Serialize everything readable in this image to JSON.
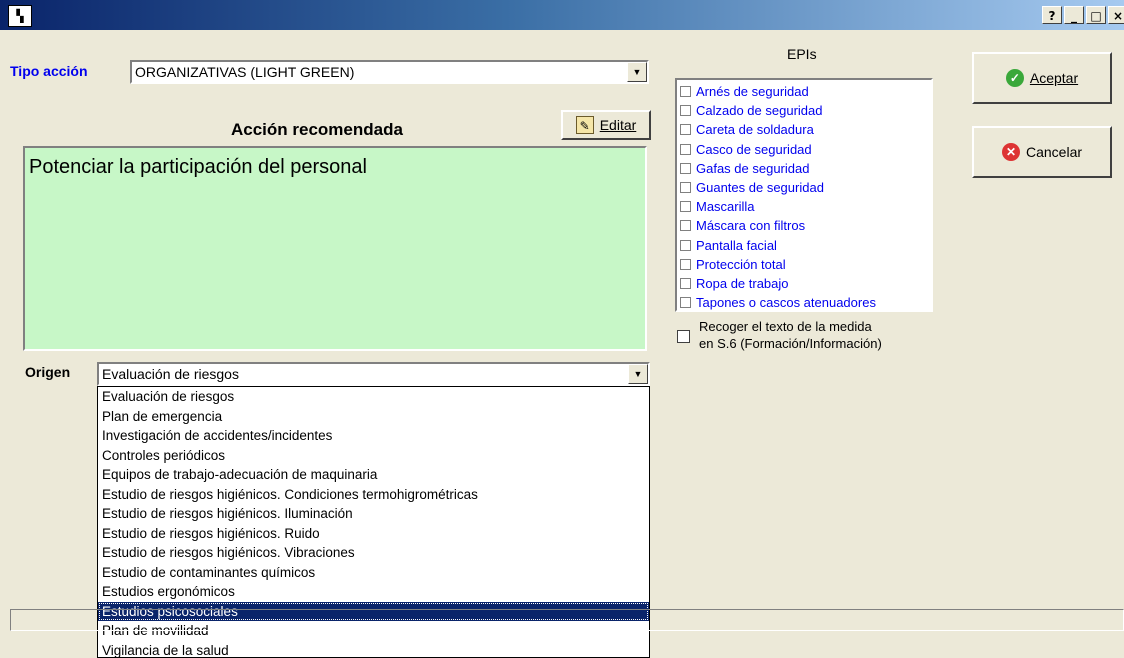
{
  "window": {
    "help_btn": "?",
    "min_btn": "_",
    "max_btn": "□",
    "close_btn": "×"
  },
  "tipo_accion": {
    "label": "Tipo acción",
    "value": "ORGANIZATIVAS (LIGHT GREEN)"
  },
  "accion": {
    "heading": "Acción recomendada",
    "edit_label": "Editar",
    "text": "Potenciar la participación del personal"
  },
  "origen": {
    "label": "Origen",
    "value": "Evaluación de riesgos",
    "options": [
      "Evaluación de riesgos",
      "Plan de emergencia",
      "Investigación de accidentes/incidentes",
      "Controles periódicos",
      "Equipos de trabajo-adecuación de maquinaria",
      "Estudio de riesgos higiénicos. Condiciones termohigrométricas",
      "Estudio de riesgos higiénicos. Iluminación",
      "Estudio de riesgos higiénicos. Ruido",
      "Estudio de riesgos higiénicos. Vibraciones",
      "Estudio de contaminantes químicos",
      "Estudios ergonómicos",
      "Estudios psicosociales",
      "Plan de movilidad",
      "Vigilancia de la salud"
    ],
    "highlighted_index": 11
  },
  "epis": {
    "title": "EPIs",
    "items": [
      "Arnés de seguridad",
      "Calzado de seguridad",
      "Careta de soldadura",
      "Casco de seguridad",
      "Gafas de seguridad",
      "Guantes de seguridad",
      "Mascarilla",
      "Máscara con filtros",
      "Pantalla facial",
      "Protección total",
      "Ropa de trabajo",
      "Tapones o cascos atenuadores"
    ],
    "recoger_line1": "Recoger el texto de la medida",
    "recoger_line2": "en S.6 (Formación/Información)"
  },
  "buttons": {
    "accept": "Aceptar",
    "cancel": "Cancelar"
  },
  "colors": {
    "title_blue": "#0a246a",
    "action_bg": "#c7f7c7",
    "label_blue": "#0000ee"
  }
}
